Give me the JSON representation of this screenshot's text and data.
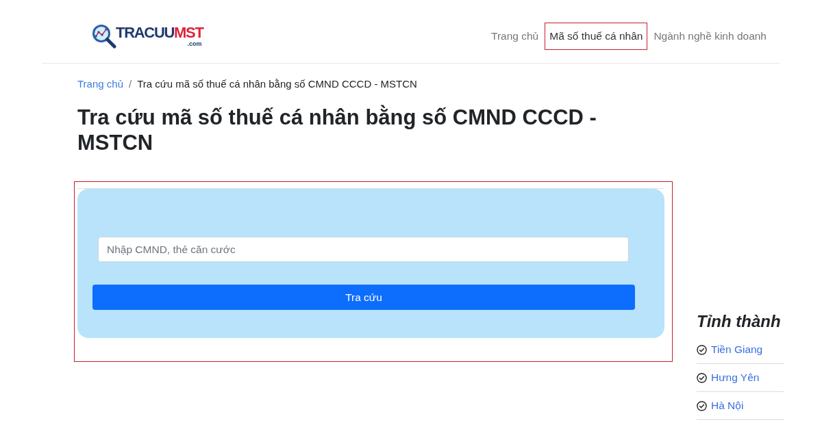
{
  "header": {
    "logo": {
      "word_1": "TRACUU",
      "word_2": "MST",
      "domain": ".com"
    },
    "nav": [
      {
        "label": "Trang chủ",
        "selected": false
      },
      {
        "label": "Mã số thuế cá nhân",
        "selected": true
      },
      {
        "label": "Ngành nghề kinh doanh",
        "selected": false
      }
    ]
  },
  "breadcrumb": {
    "separator": "/",
    "items": [
      {
        "label": "Trang chủ",
        "kind": "link"
      },
      {
        "label": "Tra cứu mã số thuế cá nhân bằng số CMND CCCD - MSTCN",
        "kind": "current"
      }
    ]
  },
  "title": "Tra cứu mã số thuế cá nhân bằng số CMND CCCD - MSTCN",
  "search_form": {
    "highlighted": true,
    "input": {
      "placeholder": "Nhập CMND, thẻ căn cước"
    },
    "button": "Tra cứu"
  },
  "sidebar": {
    "title": "Tỉnh thành",
    "items": [
      "Tiền Giang",
      "Hưng Yên",
      "Hà Nội"
    ]
  }
}
